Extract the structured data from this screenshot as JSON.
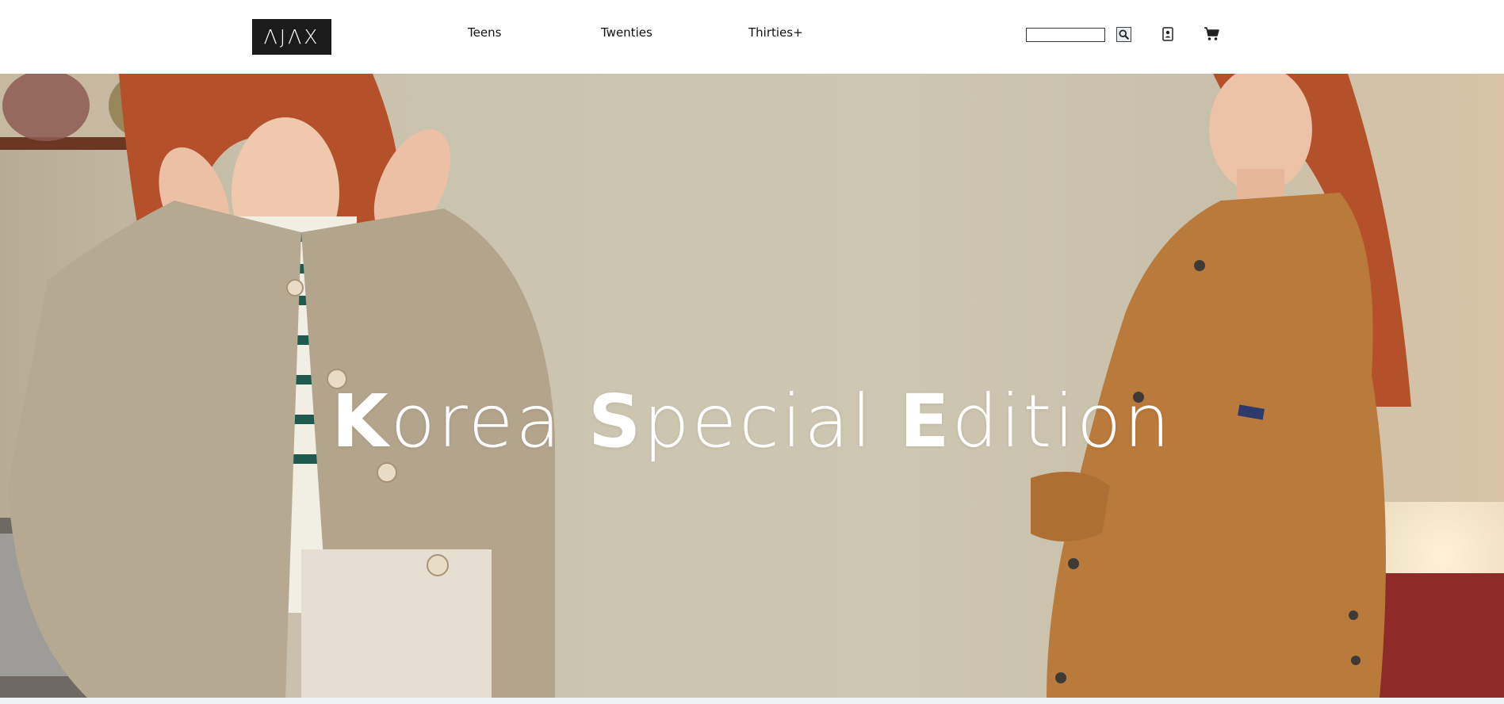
{
  "header": {
    "logo_text": "ΛJΛX",
    "nav": [
      {
        "label": "Teens"
      },
      {
        "label": "Twenties"
      },
      {
        "label": "Thirties+"
      }
    ],
    "search": {
      "placeholder": "",
      "value": ""
    },
    "icons": [
      "search-icon",
      "user-icon",
      "cart-icon"
    ]
  },
  "hero": {
    "title_parts": [
      {
        "initial": "K",
        "rest": "orea"
      },
      {
        "initial": "S",
        "rest": "pecial"
      },
      {
        "initial": "E",
        "rest": "dition"
      }
    ]
  },
  "colors": {
    "logo_bg": "#1b1b1b",
    "hero_bg": "#cdc6b0",
    "coat_left": "#b6a991",
    "coat_right": "#b97a3b",
    "hair": "#b5512a"
  }
}
